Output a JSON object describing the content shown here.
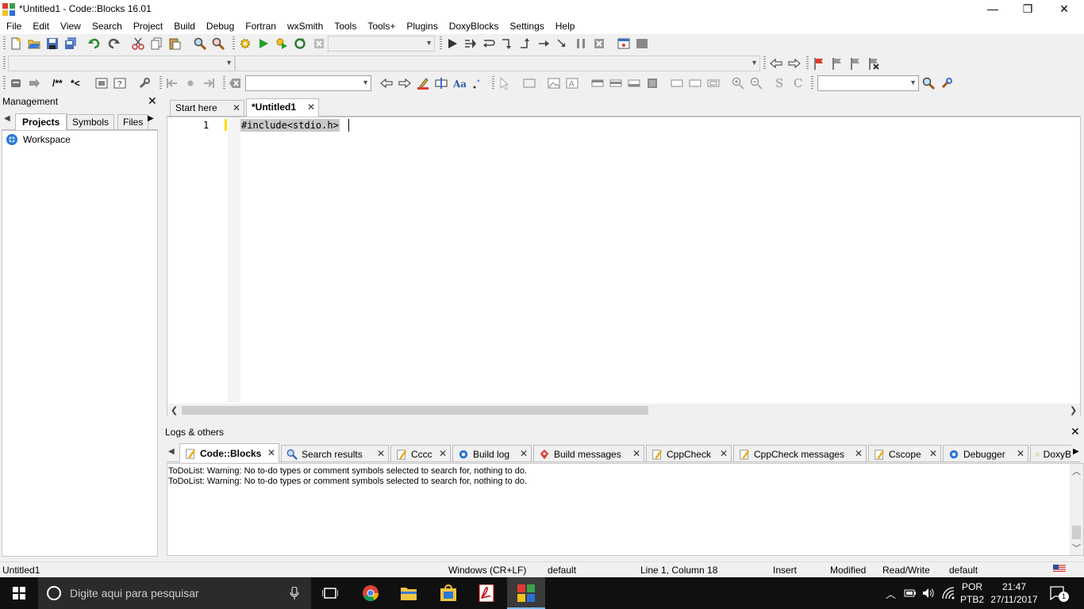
{
  "window": {
    "title": "*Untitled1 - Code::Blocks 16.01",
    "minimize": "—",
    "restore": "❐",
    "close": "✕"
  },
  "menu": [
    "File",
    "Edit",
    "View",
    "Search",
    "Project",
    "Build",
    "Debug",
    "Fortran",
    "wxSmith",
    "Tools",
    "Tools+",
    "Plugins",
    "DoxyBlocks",
    "Settings",
    "Help"
  ],
  "toolbar": {
    "comment_label": "/**",
    "uncomment_label": "*<",
    "s_label": "S",
    "c_label": "C"
  },
  "management": {
    "title": "Management",
    "tabs": [
      "Projects",
      "Symbols",
      "Files"
    ],
    "active_tab": "Projects",
    "tree_root": "Workspace"
  },
  "editor": {
    "tabs": [
      {
        "label": "Start here",
        "active": false
      },
      {
        "label": "*Untitled1",
        "active": true
      }
    ],
    "line_number": "1",
    "code": "#include<stdio.h>"
  },
  "logs": {
    "title": "Logs & others",
    "tabs": [
      "Code::Blocks",
      "Search results",
      "Cccc",
      "Build log",
      "Build messages",
      "CppCheck",
      "CppCheck messages",
      "Cscope",
      "Debugger",
      "DoxyB"
    ],
    "active_tab": "Code::Blocks",
    "lines": [
      "ToDoList: Warning: No to-do types or comment symbols selected to search for, nothing to do.",
      "ToDoList: Warning: No to-do types or comment symbols selected to search for, nothing to do."
    ]
  },
  "status": {
    "file": "Untitled1",
    "eol": "Windows (CR+LF)",
    "encoding": "default",
    "position": "Line 1, Column 18",
    "mode": "Insert",
    "modified": "Modified",
    "access": "Read/Write",
    "profile": "default"
  },
  "taskbar": {
    "search_placeholder": "Digite aqui para pesquisar",
    "lang_top": "POR",
    "lang_bottom": "PTB2",
    "time": "21:47",
    "date": "27/11/2017",
    "notification_count": "1"
  },
  "colors": {
    "accent": "#0078d7",
    "selection": "#c0c0c0",
    "taskbar_bg": "#101010",
    "change_bar": "#ffd800"
  }
}
